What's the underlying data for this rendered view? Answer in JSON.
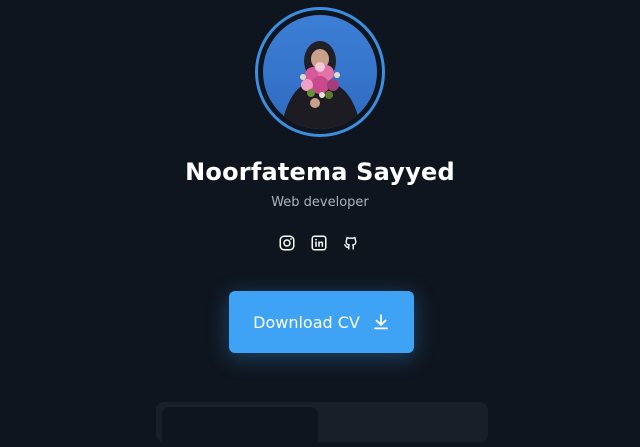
{
  "profile": {
    "name": "Noorfatema Sayyed",
    "role": "Web developer"
  },
  "socials": [
    {
      "icon": "instagram-icon"
    },
    {
      "icon": "linkedin-icon"
    },
    {
      "icon": "github-icon"
    }
  ],
  "cv_button": {
    "label": "Download CV",
    "icon": "download-icon"
  },
  "colors": {
    "background": "#0f151e",
    "accent": "#3ea2f5",
    "ring": "#3b8fe0"
  }
}
